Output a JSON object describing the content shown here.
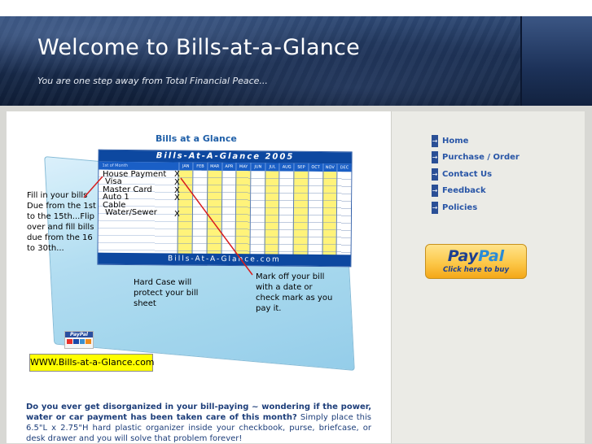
{
  "header": {
    "title": "Welcome to Bills-at-a-Glance",
    "tagline": "You are one step away from Total Financial Peace..."
  },
  "product": {
    "title": "Bills at a Glance",
    "sheet_header": "Bills-At-A-Glance 2005",
    "sheet_footer": "Bills-At-A-Glance.com",
    "month_header_label": "1st of Month",
    "months": [
      "JAN",
      "FEB",
      "MAR",
      "APR",
      "MAY",
      "JUN",
      "JUL",
      "AUG",
      "SEP",
      "OCT",
      "NOV",
      "DEC"
    ],
    "bills": [
      "House Payment",
      "Visa",
      "Master Card",
      "Auto 1",
      "Cable",
      "Water/Sewer"
    ],
    "marks": [
      "X",
      "X",
      "X",
      "X",
      "",
      "X"
    ],
    "callout_left": "Fill in your bills Due from the 1st to the 15th...Flip over and fill bills due from the 16 to 30th...",
    "callout_right": "Mark off your bill with a date or check mark as you pay it.",
    "callout_case": "Hard Case will protect your bill sheet",
    "paypal_mini_label": "PayPal",
    "url_badge": "WWW.Bills-at-a-Glance.com"
  },
  "body": {
    "question": "Do you ever get disorganized in your bill-paying ~ wondering if the power, water or car payment has been taken care of this month?",
    "description": " Simply place this 6.5\"L x 2.75\"H hard plastic organizer inside your checkbook, purse, briefcase, or desk drawer and you will solve that problem forever!"
  },
  "nav": {
    "items": [
      {
        "label": "Home",
        "icon": "arrow-right-icon"
      },
      {
        "label": "Purchase / Order",
        "icon": "arrow-right-icon"
      },
      {
        "label": "Contact Us",
        "icon": "arrow-right-icon"
      },
      {
        "label": "Feedback",
        "icon": "arrow-right-icon"
      },
      {
        "label": "Policies",
        "icon": "arrow-right-icon"
      }
    ]
  },
  "paypal_button": {
    "logo_pay": "Pay",
    "logo_pal": "Pal",
    "subtitle": "Click here to buy"
  },
  "colors": {
    "header_bg": "#1b2f52",
    "nav_link": "#2855a6",
    "body_text": "#1d3e7a",
    "title_blue": "#1f5fa8",
    "sheet_blue": "#0d48a0",
    "highlight_yellow": "#ffff00"
  }
}
